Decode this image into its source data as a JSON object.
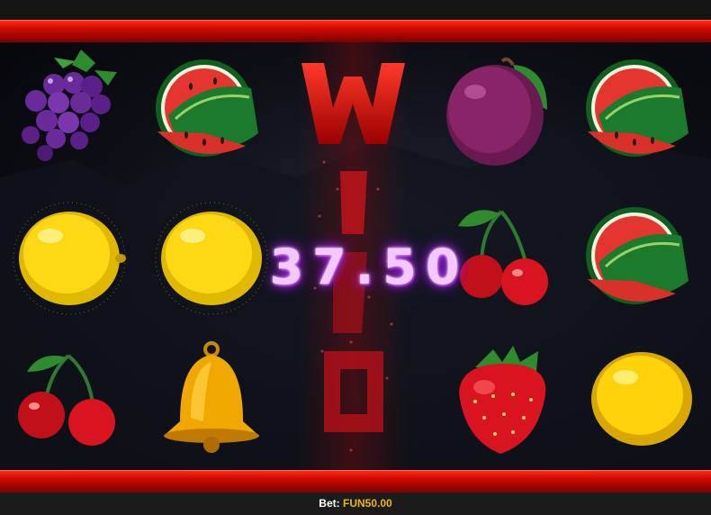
{
  "win": {
    "amount": "37.50"
  },
  "footer": {
    "bet_label": "Bet:",
    "bet_value": "FUN50.00"
  },
  "reels": [
    [
      "grapes-symbol",
      "lemon-symbol",
      "cherries-symbol"
    ],
    [
      "watermelon-symbol",
      "lemon-symbol",
      "bell-symbol"
    ],
    [
      "wild-symbol",
      "wild-symbol",
      "wild-symbol"
    ],
    [
      "plum-symbol",
      "cherries-symbol",
      "strawberry-symbol"
    ],
    [
      "watermelon-symbol",
      "watermelon-symbol",
      "lemon-symbol"
    ]
  ],
  "colors": {
    "frame_red": "#d10a00",
    "win_glow": "#c040ff",
    "bet_value": "#f0b400"
  }
}
